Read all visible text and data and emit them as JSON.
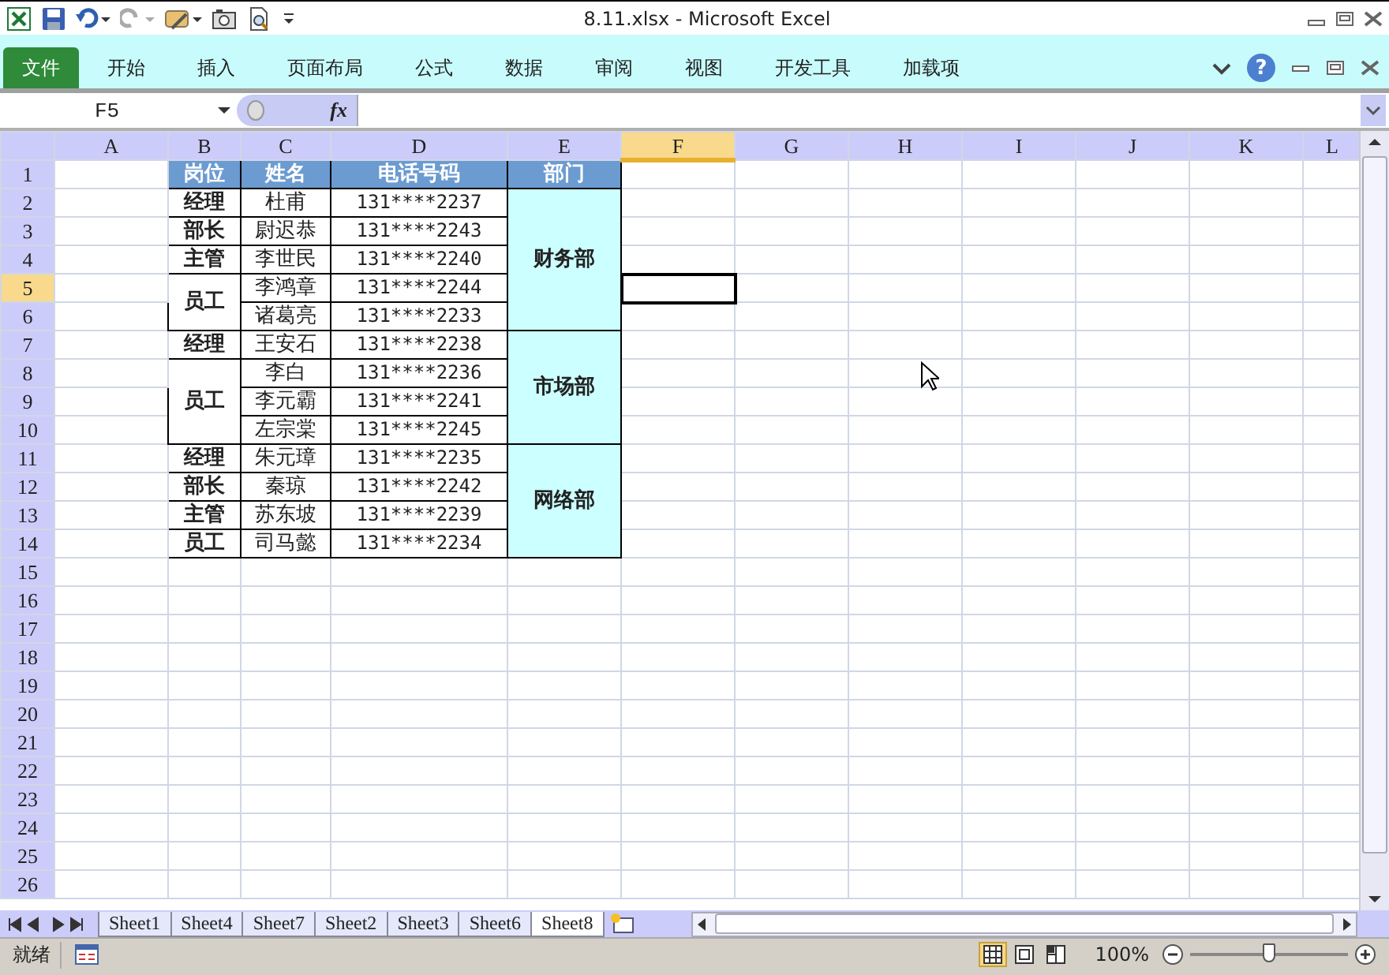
{
  "window": {
    "title": "8.11.xlsx  -  Microsoft Excel"
  },
  "ribbon_tabs": [
    {
      "label": "文件",
      "selected": true
    },
    {
      "label": "开始",
      "selected": false
    },
    {
      "label": "插入",
      "selected": false
    },
    {
      "label": "页面布局",
      "selected": false
    },
    {
      "label": "公式",
      "selected": false
    },
    {
      "label": "数据",
      "selected": false
    },
    {
      "label": "审阅",
      "selected": false
    },
    {
      "label": "视图",
      "selected": false
    },
    {
      "label": "开发工具",
      "selected": false
    },
    {
      "label": "加载项",
      "selected": false
    }
  ],
  "help": "?",
  "formula_bar": {
    "name_box": "F5",
    "function_label": "fx"
  },
  "sheet": {
    "columns": [
      {
        "label": "A",
        "selected": false
      },
      {
        "label": "B",
        "selected": false
      },
      {
        "label": "C",
        "selected": false
      },
      {
        "label": "D",
        "selected": false
      },
      {
        "label": "E",
        "selected": false
      },
      {
        "label": "F",
        "selected": true
      },
      {
        "label": "G",
        "selected": false
      },
      {
        "label": "H",
        "selected": false
      },
      {
        "label": "I",
        "selected": false
      },
      {
        "label": "J",
        "selected": false
      },
      {
        "label": "K",
        "selected": false
      },
      {
        "label": "L",
        "selected": false
      }
    ],
    "rows": [
      {
        "label": "1",
        "selected": false
      },
      {
        "label": "2",
        "selected": false
      },
      {
        "label": "3",
        "selected": false
      },
      {
        "label": "4",
        "selected": false
      },
      {
        "label": "5",
        "selected": true
      },
      {
        "label": "6",
        "selected": false
      },
      {
        "label": "7",
        "selected": false
      },
      {
        "label": "8",
        "selected": false
      },
      {
        "label": "9",
        "selected": false
      },
      {
        "label": "10",
        "selected": false
      },
      {
        "label": "11",
        "selected": false
      },
      {
        "label": "12",
        "selected": false
      },
      {
        "label": "13",
        "selected": false
      },
      {
        "label": "14",
        "selected": false
      },
      {
        "label": "15",
        "selected": false
      },
      {
        "label": "16",
        "selected": false
      },
      {
        "label": "17",
        "selected": false
      },
      {
        "label": "18",
        "selected": false
      },
      {
        "label": "19",
        "selected": false
      },
      {
        "label": "20",
        "selected": false
      },
      {
        "label": "21",
        "selected": false
      },
      {
        "label": "22",
        "selected": false
      },
      {
        "label": "23",
        "selected": false
      },
      {
        "label": "24",
        "selected": false
      },
      {
        "label": "25",
        "selected": false
      },
      {
        "label": "26",
        "selected": false
      }
    ],
    "table": {
      "headers": [
        "岗位",
        "姓名",
        "电话号码",
        "部门"
      ],
      "departments": [
        {
          "name": "财务部",
          "positions": [
            {
              "title": "经理",
              "people": [
                {
                  "name": "杜甫",
                  "phone": "131****2237"
                }
              ]
            },
            {
              "title": "部长",
              "people": [
                {
                  "name": "尉迟恭",
                  "phone": "131****2243"
                }
              ]
            },
            {
              "title": "主管",
              "people": [
                {
                  "name": "李世民",
                  "phone": "131****2240"
                }
              ]
            },
            {
              "title": "员工",
              "people": [
                {
                  "name": "李鸿章",
                  "phone": "131****2244"
                },
                {
                  "name": "诸葛亮",
                  "phone": "131****2233"
                }
              ]
            }
          ]
        },
        {
          "name": "市场部",
          "positions": [
            {
              "title": "经理",
              "people": [
                {
                  "name": "王安石",
                  "phone": "131****2238"
                }
              ]
            },
            {
              "title": "员工",
              "people": [
                {
                  "name": "李白",
                  "phone": "131****2236"
                },
                {
                  "name": "李元霸",
                  "phone": "131****2241"
                },
                {
                  "name": "左宗棠",
                  "phone": "131****2245"
                }
              ]
            }
          ]
        },
        {
          "name": "网络部",
          "positions": [
            {
              "title": "经理",
              "people": [
                {
                  "name": "朱元璋",
                  "phone": "131****2235"
                }
              ]
            },
            {
              "title": "部长",
              "people": [
                {
                  "name": "秦琼",
                  "phone": "131****2242"
                }
              ]
            },
            {
              "title": "主管",
              "people": [
                {
                  "name": "苏东坡",
                  "phone": "131****2239"
                }
              ]
            },
            {
              "title": "员工",
              "people": [
                {
                  "name": "司马懿",
                  "phone": "131****2234"
                }
              ]
            }
          ]
        }
      ]
    }
  },
  "sheet_tabs": [
    {
      "label": "Sheet1",
      "selected": false
    },
    {
      "label": "Sheet4",
      "selected": false
    },
    {
      "label": "Sheet7",
      "selected": false
    },
    {
      "label": "Sheet2",
      "selected": false
    },
    {
      "label": "Sheet3",
      "selected": false
    },
    {
      "label": "Sheet6",
      "selected": false
    },
    {
      "label": "Sheet8",
      "selected": true
    }
  ],
  "status_bar": {
    "status": "就绪",
    "zoom": "100%",
    "zoom_slider": {
      "level": 0.5
    },
    "views": [
      {
        "kind": "normal",
        "selected": true
      },
      {
        "kind": "page-layout",
        "selected": false
      },
      {
        "kind": "page-break",
        "selected": false
      }
    ]
  }
}
